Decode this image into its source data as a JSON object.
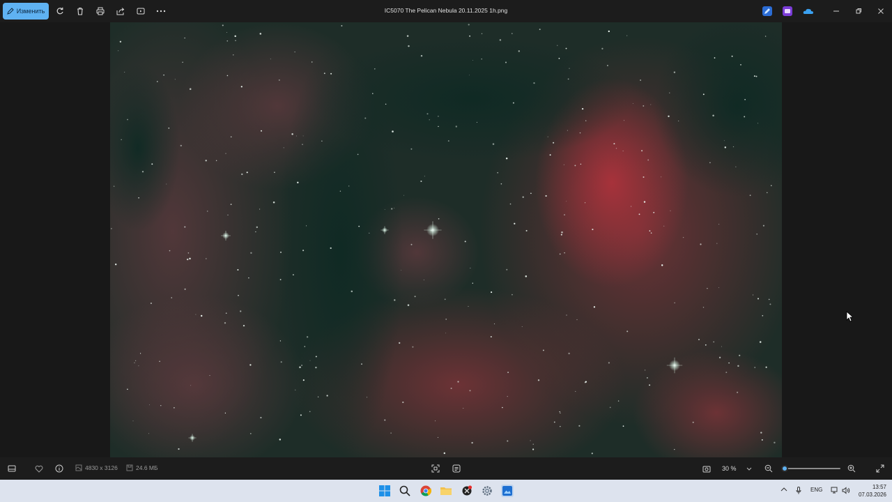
{
  "titlebar": {
    "edit_label": "Изменить",
    "file_title": "IC5070 The Pelican Nebula 20.11.2025 1h.png"
  },
  "statusbar": {
    "dimensions": "4830 x 3126",
    "file_size": "24.6 МБ",
    "zoom_level": "30 %",
    "zoom_fraction": 0.02
  },
  "taskbar": {
    "language": "ENG",
    "time": "13:57",
    "date": "07.03.2026"
  },
  "colors": {
    "accent": "#5fb2f2",
    "nebula_red": "#b0323c",
    "nebula_teal": "#1a3a33"
  },
  "icons": {
    "toolbar": [
      "rotate-icon",
      "delete-icon",
      "print-icon",
      "share-icon",
      "slideshow-icon",
      "more-icon"
    ],
    "window": [
      "minimize-icon",
      "maximize-icon",
      "close-icon"
    ],
    "status": [
      "filmstrip-icon",
      "favorite-icon",
      "info-icon",
      "fit-screen-icon",
      "ocr-icon",
      "screenshot-icon",
      "zoom-out-icon",
      "zoom-in-icon",
      "fullscreen-icon"
    ],
    "taskbar": [
      "windows-start-icon",
      "search-icon",
      "chrome-icon",
      "file-explorer-icon",
      "app-icon",
      "settings-icon",
      "photos-icon"
    ]
  }
}
